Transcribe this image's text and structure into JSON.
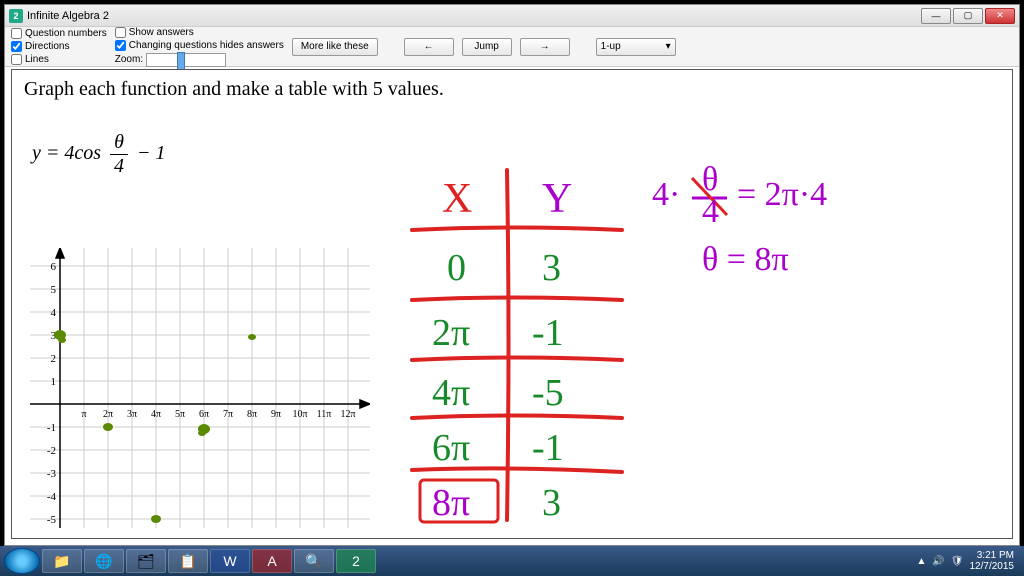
{
  "window": {
    "title": "Infinite Algebra 2"
  },
  "toolbar": {
    "question_numbers": "Question numbers",
    "directions": "Directions",
    "lines": "Lines",
    "show_answers": "Show answers",
    "changing_hides": "Changing questions hides answers",
    "zoom_label": "Zoom:",
    "more_like": "More like these",
    "prev": "←",
    "jump": "Jump",
    "next": "→",
    "layout_select": "1-up"
  },
  "content": {
    "instruction": "Graph each function and make a table with 5 values.",
    "equation_lhs": "y = 4cos",
    "equation_num": "θ",
    "equation_den": "4",
    "equation_rhs": "− 1"
  },
  "graph": {
    "y_ticks": [
      "6",
      "5",
      "4",
      "3",
      "2",
      "1",
      "-1",
      "-2",
      "-3",
      "-4",
      "-5"
    ],
    "x_ticks": [
      "π",
      "2π",
      "3π",
      "4π",
      "5π",
      "6π",
      "7π",
      "8π",
      "9π",
      "10π",
      "11π",
      "12π"
    ]
  },
  "handwriting": {
    "table_header_x": "X",
    "table_header_y": "Y",
    "rows": [
      {
        "x": "0",
        "y": "3"
      },
      {
        "x": "2π",
        "y": "-1"
      },
      {
        "x": "4π",
        "y": "-5"
      },
      {
        "x": "6π",
        "y": "-1"
      },
      {
        "x": "8π",
        "y": "3"
      }
    ],
    "eq_top": "4·(θ/4) = 2π·4",
    "eq_bottom": "θ = 8π"
  },
  "taskbar": {
    "time": "3:21 PM",
    "date": "12/7/2015"
  }
}
